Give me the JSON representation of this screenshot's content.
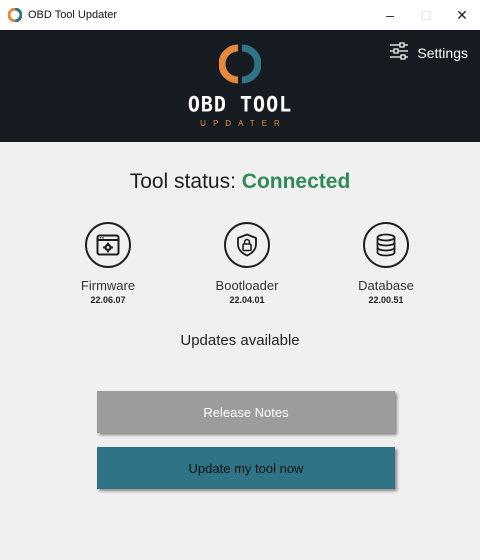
{
  "window": {
    "title": "OBD Tool Updater",
    "icon": "app-logo-icon",
    "controls": {
      "minimize": "–",
      "maximize": "□",
      "close": "✕"
    }
  },
  "header": {
    "brand_title": "OBD TOOL",
    "brand_subtitle": "UPDATER",
    "settings_label": "Settings",
    "settings_icon": "sliders-icon",
    "colors": {
      "background": "#161b22",
      "logo_orange": "#e58a3a",
      "logo_blue": "#2f7486"
    }
  },
  "status": {
    "label": "Tool status:",
    "value": "Connected",
    "value_color": "#2f8a57"
  },
  "components": [
    {
      "name": "Firmware",
      "version": "22.06.07",
      "icon": "firmware-window-gear-icon"
    },
    {
      "name": "Bootloader",
      "version": "22.04.01",
      "icon": "shield-lock-icon"
    },
    {
      "name": "Database",
      "version": "22.00.51",
      "icon": "database-icon"
    }
  ],
  "updates_text": "Updates available",
  "buttons": {
    "release_notes": "Release Notes",
    "update_now": "Update my tool now",
    "colors": {
      "release_notes_bg": "#9c9c9c",
      "update_bg": "#2f7486"
    }
  }
}
